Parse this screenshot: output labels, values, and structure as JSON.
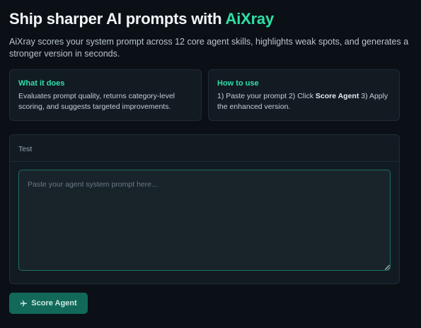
{
  "hero": {
    "title_prefix": "Ship sharper AI prompts with ",
    "title_brand": "AiXray",
    "description": "AiXray scores your system prompt across 12 core agent skills, highlights weak spots, and generates a stronger version in seconds."
  },
  "cards": {
    "what": {
      "title": "What it does",
      "body": "Evaluates prompt quality, returns category-level scoring, and suggests targeted improvements."
    },
    "how": {
      "title": "How to use",
      "step1": "1) Paste your prompt 2) Click ",
      "step_bold": "Score Agent",
      "step2": " 3) Apply the enhanced version."
    }
  },
  "panel": {
    "header": "Test",
    "placeholder": "Paste your agent system prompt here...",
    "value": ""
  },
  "actions": {
    "score_label": "Score Agent",
    "score_icon": "airplane-icon"
  },
  "colors": {
    "accent": "#2fe0a6",
    "button": "#12695a",
    "background": "#0b1016"
  }
}
